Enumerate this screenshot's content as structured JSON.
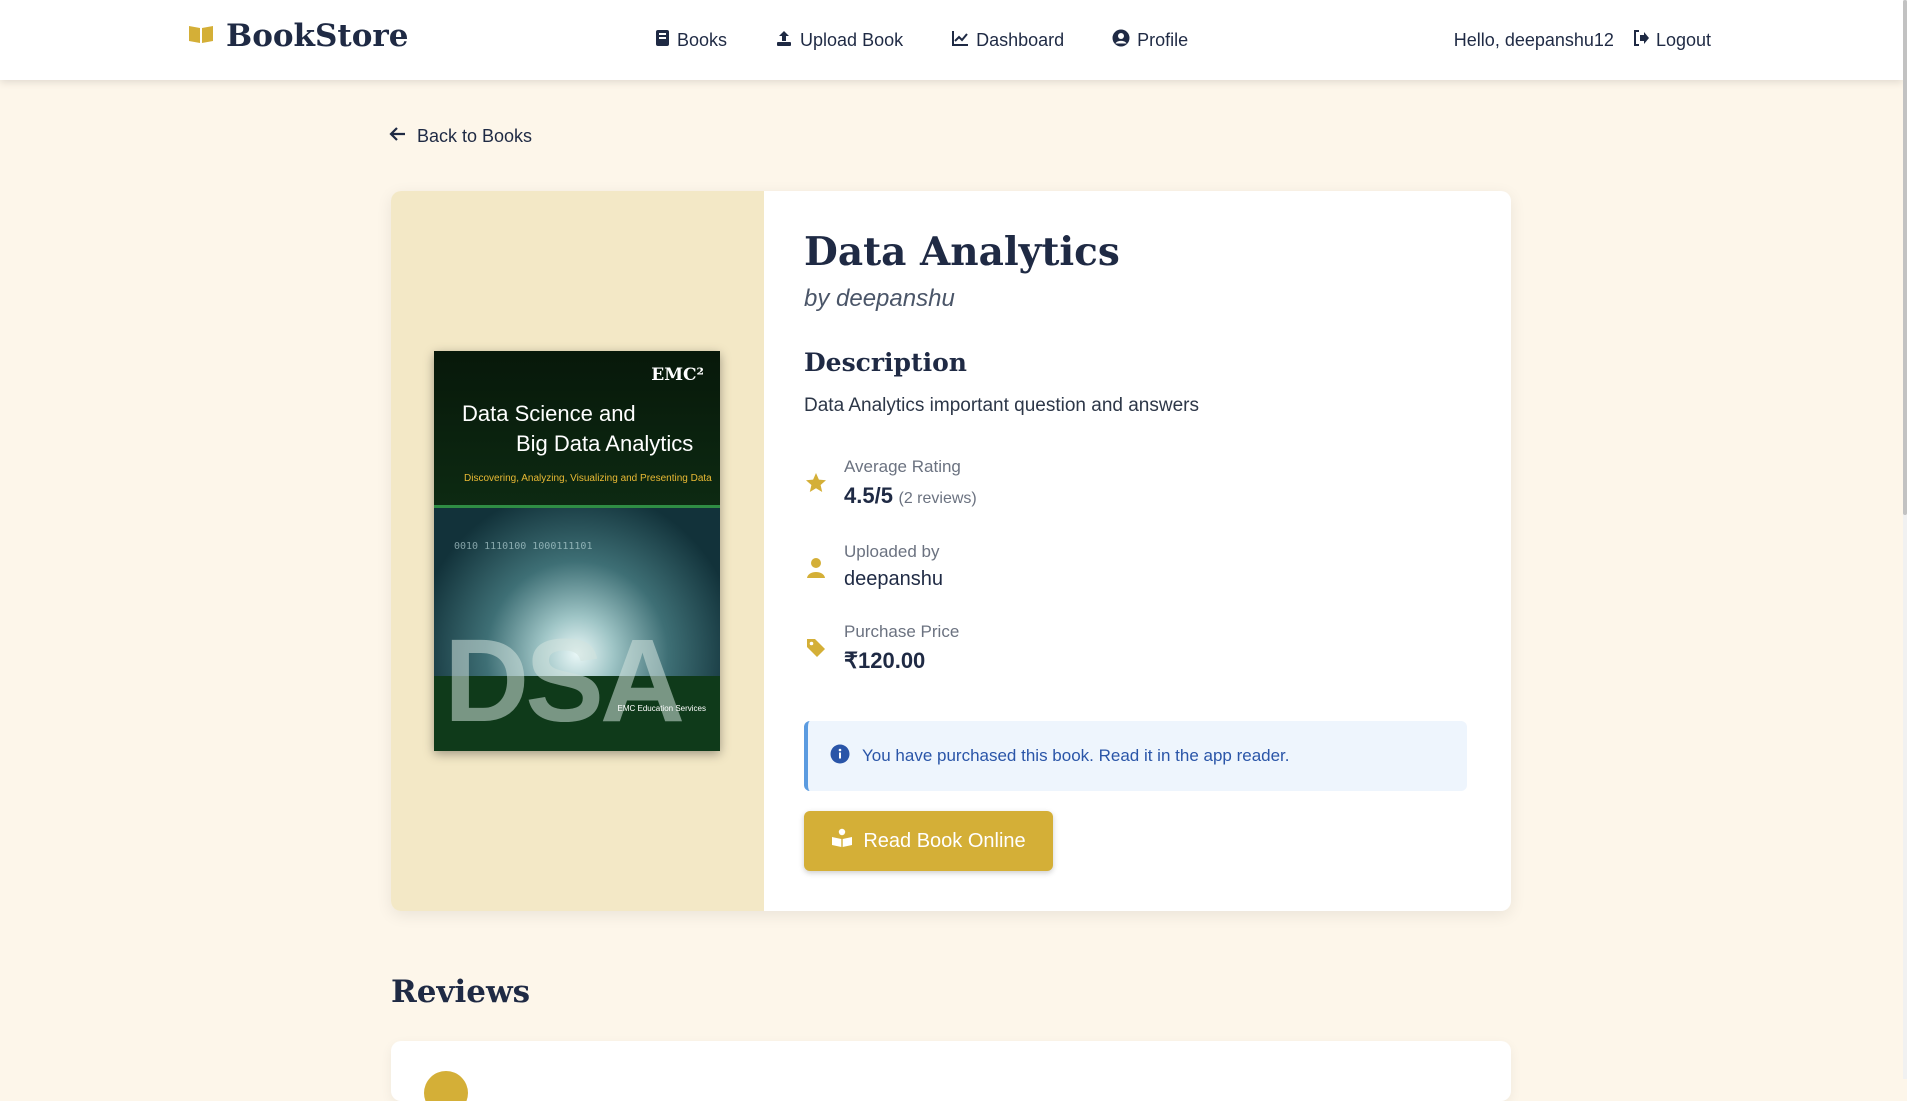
{
  "nav": {
    "brand": "BookStore",
    "links": {
      "books": "Books",
      "upload": "Upload Book",
      "dashboard": "Dashboard",
      "profile": "Profile"
    },
    "greeting": "Hello, deepanshu12",
    "logout": "Logout"
  },
  "back_label": "Back to Books",
  "book": {
    "title": "Data Analytics",
    "author": "by deepanshu",
    "description_heading": "Description",
    "description": "Data Analytics important question and answers",
    "rating_label": "Average Rating",
    "rating_value": "4.5/5",
    "rating_count": "(2 reviews)",
    "uploader_label": "Uploaded by",
    "uploader": "deepanshu",
    "price_label": "Purchase Price",
    "price": "₹120.00",
    "cover": {
      "publisher_mark": "EMC²",
      "title_line1": "Data Science and",
      "title_line2": "Big Data Analytics",
      "subtitle": "Discovering, Analyzing, Visualizing and Presenting Data",
      "binary_text": "0010 1110100 1000111101",
      "big_letters": "DSA",
      "publisher": "EMC Education Services"
    }
  },
  "alert": "You have purchased this book. Read it in the app reader.",
  "read_button": "Read Book Online",
  "reviews_heading": "Reviews",
  "colors": {
    "accent": "#d4af37",
    "background": "#fdf6ea",
    "cover_pane": "#f3e8c6",
    "text": "#1f2a44",
    "info_blue": "#2a55a8"
  }
}
